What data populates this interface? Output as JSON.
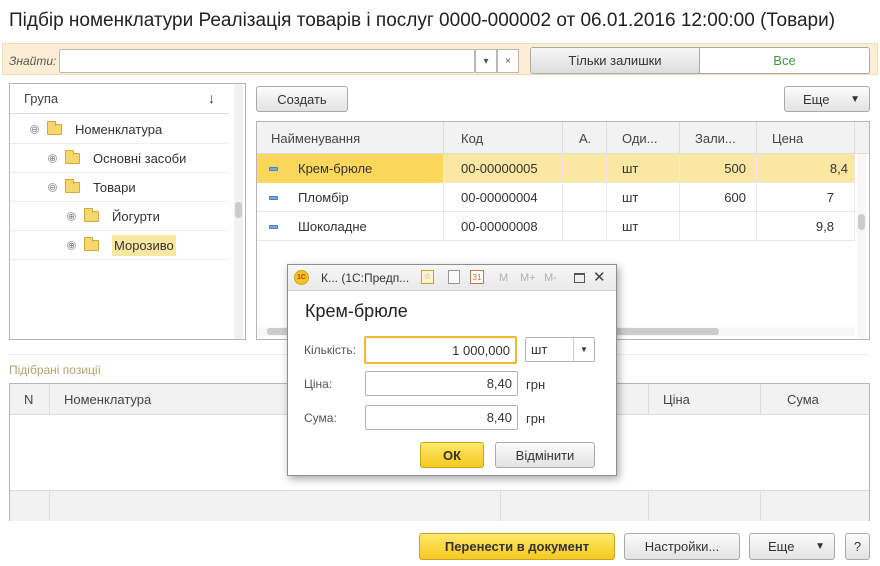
{
  "window_title": "Підбір номенклатури Реалізація товарів і послуг 0000-000002 от 06.01.2016 12:00:00 (Товари)",
  "search": {
    "label": "Знайти:",
    "value": "",
    "dropdown_icon": "chevron-down",
    "clear_icon": "×"
  },
  "filter_toggle": {
    "left": "Тільки залишки",
    "right": "Все"
  },
  "tree": {
    "header": "Група",
    "sort_icon": "↓",
    "items": [
      {
        "label": "Номенклатура",
        "expander": "⊖"
      },
      {
        "label": "Основні засоби",
        "expander": "⊕"
      },
      {
        "label": "Товари",
        "expander": "⊖"
      },
      {
        "label": "Йогурти",
        "expander": "⊕"
      },
      {
        "label": "Морозиво",
        "expander": "⊕"
      }
    ]
  },
  "toolbar": {
    "create": "Создать",
    "more": "Еще"
  },
  "products": {
    "columns": [
      "Найменування",
      "Код",
      "А.",
      "Оди...",
      "Зали...",
      "Цена"
    ],
    "rows": [
      {
        "name": "Крем-брюле",
        "code": "00-00000005",
        "a": "",
        "unit": "шт",
        "stock": "500",
        "price": "8,4"
      },
      {
        "name": "Пломбір",
        "code": "00-00000004",
        "a": "",
        "unit": "шт",
        "stock": "600",
        "price": "7"
      },
      {
        "name": "Шоколадне",
        "code": "00-00000008",
        "a": "",
        "unit": "шт",
        "stock": "",
        "price": "9,8"
      }
    ]
  },
  "selected": {
    "label": "Підібрані позиції",
    "columns": [
      "N",
      "Номенклатура",
      "Ціна",
      "Сума"
    ]
  },
  "footer": {
    "transfer": "Перенести в документ",
    "settings": "Настройки...",
    "more": "Еще",
    "help": "?"
  },
  "dialog": {
    "title": "К...  (1С:Предп...",
    "toolbar_icons": [
      "M",
      "M+",
      "M-"
    ],
    "heading": "Крем-брюле",
    "quantity_label": "Кількість:",
    "quantity_value": "1 000,000",
    "unit": "шт",
    "price_label": "Ціна:",
    "price_value": "8,40",
    "price_currency": "грн",
    "sum_label": "Сума:",
    "sum_value": "8,40",
    "sum_currency": "грн",
    "ok": "ОК",
    "cancel": "Відмінити"
  },
  "colors": {
    "highlight": "#fbe6a2",
    "selected_row": "#fbd85b",
    "accent_green": "#3c9a3c"
  }
}
